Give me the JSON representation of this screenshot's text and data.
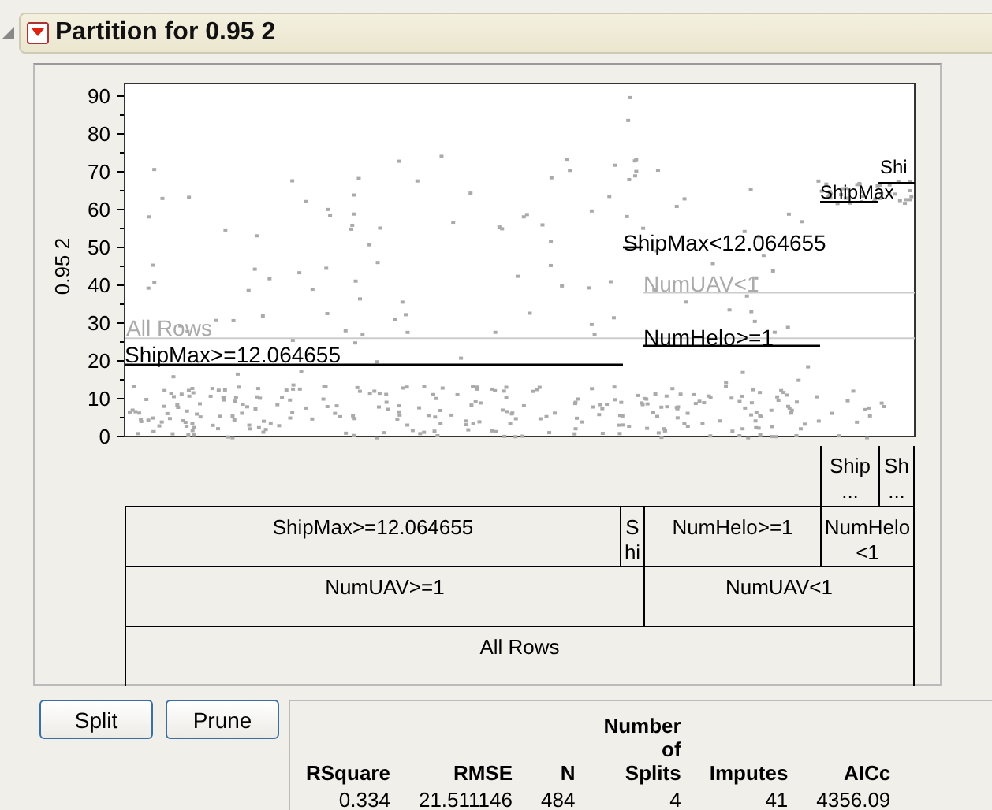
{
  "outline": {
    "title": "Partition for 0.95 2",
    "expanded": true
  },
  "plot": {
    "y_axis_label": "0.95 2",
    "y_ticks": [
      "90",
      "80",
      "70",
      "60",
      "50",
      "40",
      "30",
      "20",
      "10",
      "0"
    ],
    "split_labels": [
      {
        "text": "All Rows",
        "kind": "inactive"
      },
      {
        "text": "ShipMax>=12.064655",
        "kind": "active"
      },
      {
        "text": "ShipMax<12.064655",
        "kind": "active"
      },
      {
        "text": "NumUAV<1",
        "kind": "inactive"
      },
      {
        "text": "NumHelo>=1",
        "kind": "active"
      },
      {
        "text": "ShipMax",
        "kind": "active"
      },
      {
        "text": "Shi",
        "kind": "active"
      }
    ]
  },
  "tree": [
    {
      "cells": [
        {
          "text": ""
        },
        {
          "text": "Ship ..."
        },
        {
          "text": "Sh ..."
        }
      ]
    },
    {
      "cells": [
        {
          "text": "ShipMax>=12.064655"
        },
        {
          "text": "Shi"
        },
        {
          "text": "NumHelo>=1"
        },
        {
          "text": "NumHelo<1"
        }
      ]
    },
    {
      "cells": [
        {
          "text": "NumUAV>=1"
        },
        {
          "text": "NumUAV<1"
        }
      ]
    },
    {
      "cells": [
        {
          "text": "All Rows"
        }
      ]
    }
  ],
  "buttons": [
    "Split",
    "Prune"
  ],
  "summary": {
    "columns": [
      "RSquare",
      "RMSE",
      "N",
      "Number of Splits",
      "Imputes",
      "AICc"
    ],
    "values": [
      "0.334",
      "21.511146",
      "484",
      "4",
      "41",
      "4356.09"
    ]
  }
}
